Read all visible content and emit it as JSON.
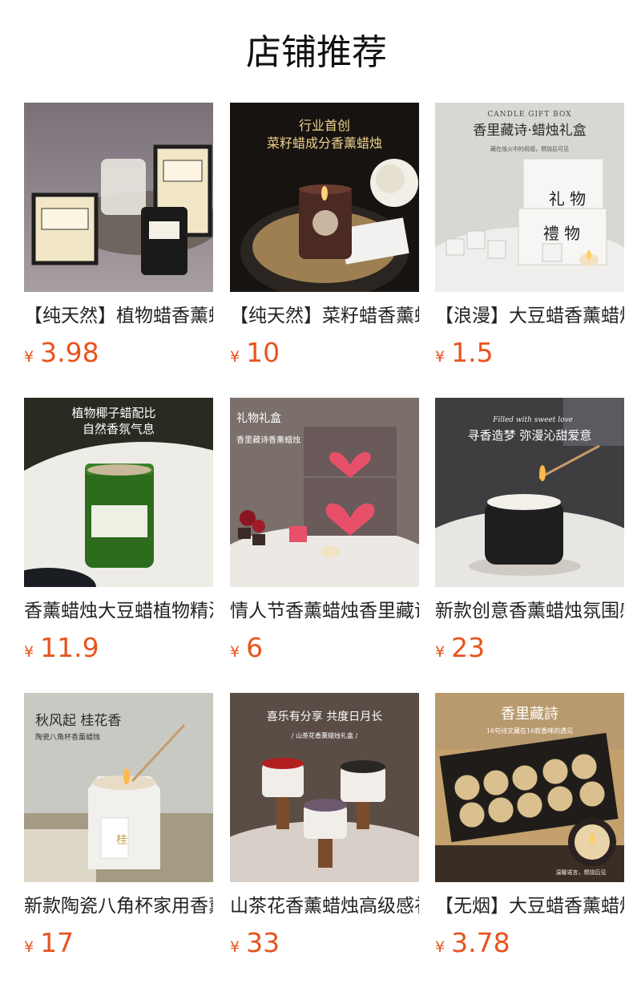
{
  "page": {
    "title": "店铺推荐"
  },
  "currency_symbol": "¥",
  "colors": {
    "price": "#e8541e",
    "text": "#222222"
  },
  "products": [
    {
      "name": "【纯天然】植物蜡香薰蜡烛",
      "price": "3.98",
      "image": {
        "alt": "candle-gift-boxes-photo"
      }
    },
    {
      "name": "【纯天然】菜籽蜡香薰蜡烛",
      "price": "10",
      "image": {
        "alt": "rapeseed-wax-candle-photo",
        "overlay_line1": "行业首创",
        "overlay_line2": "菜籽蜡成分香薰蜡烛"
      }
    },
    {
      "name": "【浪漫】大豆蜡香薰蜡烛礼盒",
      "price": "1.5",
      "image": {
        "alt": "candle-gift-box-photo",
        "overlay_small": "CANDLE GIFT BOX",
        "overlay_line1": "香里藏诗·蜡烛礼盒",
        "overlay_line2": "藏在烛火中的祝福，燃烧后可见",
        "box_text1": "礼 物",
        "box_text2": "禮 物"
      }
    },
    {
      "name": "香薰蜡烛大豆蜡植物精油",
      "price": "11.9",
      "image": {
        "alt": "green-jar-candle-photo",
        "overlay_line1": "植物椰子蜡配比",
        "overlay_line2": "自然香氛气息"
      }
    },
    {
      "name": "情人节香薰蜡烛香里藏诗",
      "price": "6",
      "image": {
        "alt": "valentine-heart-box-photo",
        "overlay_line1": "礼物礼盒",
        "overlay_line2": "香里藏诗香薰蜡烛"
      }
    },
    {
      "name": "新款创意香薰蜡烛氛围感",
      "price": "23",
      "image": {
        "alt": "black-stone-candle-photo",
        "overlay_small": "Filled with sweet love",
        "overlay_line1": "寻香造梦  弥漫沁甜爱意"
      }
    },
    {
      "name": "新款陶瓷八角杯家用香薰",
      "price": "17",
      "image": {
        "alt": "octagon-ceramic-candle-photo",
        "overlay_line1": "秋风起  桂花香",
        "overlay_line2": "陶瓷八角杯香薰蜡烛",
        "cup_text": "桂"
      }
    },
    {
      "name": "山茶花香薰蜡烛高级感礼盒",
      "price": "33",
      "image": {
        "alt": "camellia-candles-photo",
        "overlay_line1": "喜乐有分享  共度日月长",
        "overlay_line2": "/ 山茶花香薰蜡烛礼盒 /"
      }
    },
    {
      "name": "【无烟】大豆蜡香薰蜡烛",
      "price": "3.78",
      "image": {
        "alt": "poem-candle-set-photo",
        "overlay_line1": "香里藏詩",
        "overlay_line2": "16句诗文藏在16款香味的遇见",
        "overlay_line3": "温暖诺言，燃烧后见"
      }
    }
  ]
}
